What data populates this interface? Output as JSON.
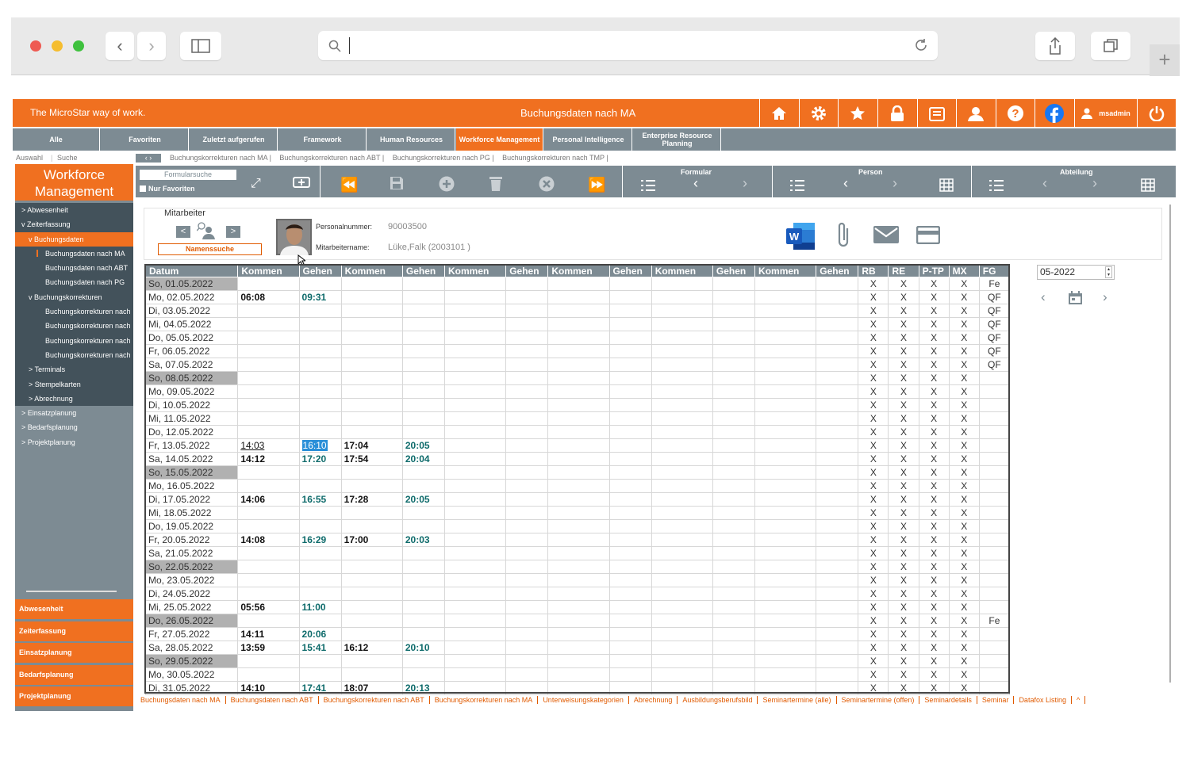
{
  "browser": {
    "address_value": ""
  },
  "app": {
    "brand": "The MicroStar way of work.",
    "page_title": "Buchungsdaten nach MA",
    "user": "msadmin",
    "nav_tabs": [
      "Alle",
      "Favoriten",
      "Zuletzt aufgerufen",
      "Framework",
      "Human Resources",
      "Workforce Management",
      "Personal Intelligence",
      "Enterprise Resource Planning"
    ],
    "sub_left": [
      "Auswahl",
      "Suche"
    ],
    "breadcrumbs": [
      "Buchungskorrekturen nach MA",
      "Buchungskorrekturen nach ABT",
      "Buchungskorrekturen nach PG",
      "Buchungskorrekturen nach TMP"
    ]
  },
  "sidebar": {
    "title": "Workforce Management",
    "tree": [
      {
        "label": "> Abwesenheit",
        "indent": 1,
        "style": "dark"
      },
      {
        "label": "v Zeiterfassung",
        "indent": 1,
        "style": "dark"
      },
      {
        "label": "v Buchungsdaten",
        "indent": 2,
        "style": "hl"
      },
      {
        "label": "Buchungsdaten nach MA",
        "indent": 3,
        "style": "dark",
        "marker": true
      },
      {
        "label": "Buchungsdaten nach ABT",
        "indent": 3,
        "style": "dark"
      },
      {
        "label": "Buchungsdaten nach PG",
        "indent": 3,
        "style": "dark"
      },
      {
        "label": "v Buchungskorrekturen",
        "indent": 2,
        "style": "dark"
      },
      {
        "label": "Buchungskorrekturen nach",
        "indent": 3,
        "style": "dark"
      },
      {
        "label": "Buchungskorrekturen nach",
        "indent": 3,
        "style": "dark"
      },
      {
        "label": "Buchungskorrekturen nach",
        "indent": 3,
        "style": "dark"
      },
      {
        "label": "Buchungskorrekturen nach",
        "indent": 3,
        "style": "dark"
      },
      {
        "label": "> Terminals",
        "indent": 2,
        "style": "dark"
      },
      {
        "label": "> Stempelkarten",
        "indent": 2,
        "style": "dark"
      },
      {
        "label": "> Abrechnung",
        "indent": 2,
        "style": "dark"
      },
      {
        "label": "> Einsatzplanung",
        "indent": 1,
        "style": ""
      },
      {
        "label": "> Bedarfsplanung",
        "indent": 1,
        "style": ""
      },
      {
        "label": "> Projektplanung",
        "indent": 1,
        "style": ""
      }
    ],
    "bottom_buttons": [
      "Abwesenheit",
      "Zeiterfassung",
      "Einsatzplanung",
      "Bedarfsplanung",
      "Projektplanung"
    ]
  },
  "toolbar": {
    "form_search": "Formularsuche",
    "only_favorites": "Nur Favoriten",
    "groups": [
      "Formular",
      "Person",
      "Abteilung"
    ]
  },
  "employee": {
    "legend": "Mitarbeiter",
    "name_search": "Namenssuche",
    "personal_number_label": "Personalnummer:",
    "personal_number": "90003500",
    "name_label": "Mitarbeitername:",
    "name": "Lüke,Falk (2003101 )"
  },
  "period": {
    "value": "05-2022"
  },
  "grid": {
    "headers": [
      "Datum",
      "Kommen",
      "Gehen",
      "Kommen",
      "Gehen",
      "Kommen",
      "Gehen",
      "Kommen",
      "Gehen",
      "Kommen",
      "Gehen",
      "Kommen",
      "Gehen",
      "RB",
      "RE",
      "P-TP",
      "MX",
      "FG"
    ],
    "rows": [
      [
        "So, 01.05.2022",
        "",
        "",
        "",
        "",
        "X",
        "X",
        "X",
        "X",
        "Fe",
        true
      ],
      [
        "Mo, 02.05.2022",
        "06:08",
        "09:31",
        "",
        "",
        "X",
        "X",
        "X",
        "X",
        "QF",
        false
      ],
      [
        "Di, 03.05.2022",
        "",
        "",
        "",
        "",
        "X",
        "X",
        "X",
        "X",
        "QF",
        false
      ],
      [
        "Mi, 04.05.2022",
        "",
        "",
        "",
        "",
        "X",
        "X",
        "X",
        "X",
        "QF",
        false
      ],
      [
        "Do, 05.05.2022",
        "",
        "",
        "",
        "",
        "X",
        "X",
        "X",
        "X",
        "QF",
        false
      ],
      [
        "Fr, 06.05.2022",
        "",
        "",
        "",
        "",
        "X",
        "X",
        "X",
        "X",
        "QF",
        false
      ],
      [
        "Sa, 07.05.2022",
        "",
        "",
        "",
        "",
        "X",
        "X",
        "X",
        "X",
        "QF",
        false
      ],
      [
        "So, 08.05.2022",
        "",
        "",
        "",
        "",
        "X",
        "X",
        "X",
        "X",
        "",
        true
      ],
      [
        "Mo, 09.05.2022",
        "",
        "",
        "",
        "",
        "X",
        "X",
        "X",
        "X",
        "",
        false
      ],
      [
        "Di, 10.05.2022",
        "",
        "",
        "",
        "",
        "X",
        "X",
        "X",
        "X",
        "",
        false
      ],
      [
        "Mi, 11.05.2022",
        "",
        "",
        "",
        "",
        "X",
        "X",
        "X",
        "X",
        "",
        false
      ],
      [
        "Do, 12.05.2022",
        "",
        "",
        "",
        "",
        "X",
        "X",
        "X",
        "X",
        "",
        false
      ],
      [
        "Fr, 13.05.2022",
        "14:03",
        "16:10",
        "17:04",
        "20:05",
        "X",
        "X",
        "X",
        "X",
        "",
        false
      ],
      [
        "Sa, 14.05.2022",
        "14:12",
        "17:20",
        "17:54",
        "20:04",
        "X",
        "X",
        "X",
        "X",
        "",
        false
      ],
      [
        "So, 15.05.2022",
        "",
        "",
        "",
        "",
        "X",
        "X",
        "X",
        "X",
        "",
        true
      ],
      [
        "Mo, 16.05.2022",
        "",
        "",
        "",
        "",
        "X",
        "X",
        "X",
        "X",
        "",
        false
      ],
      [
        "Di, 17.05.2022",
        "14:06",
        "16:55",
        "17:28",
        "20:05",
        "X",
        "X",
        "X",
        "X",
        "",
        false
      ],
      [
        "Mi, 18.05.2022",
        "",
        "",
        "",
        "",
        "X",
        "X",
        "X",
        "X",
        "",
        false
      ],
      [
        "Do, 19.05.2022",
        "",
        "",
        "",
        "",
        "X",
        "X",
        "X",
        "X",
        "",
        false
      ],
      [
        "Fr, 20.05.2022",
        "14:08",
        "16:29",
        "17:00",
        "20:03",
        "X",
        "X",
        "X",
        "X",
        "",
        false
      ],
      [
        "Sa, 21.05.2022",
        "",
        "",
        "",
        "",
        "X",
        "X",
        "X",
        "X",
        "",
        false
      ],
      [
        "So, 22.05.2022",
        "",
        "",
        "",
        "",
        "X",
        "X",
        "X",
        "X",
        "",
        true
      ],
      [
        "Mo, 23.05.2022",
        "",
        "",
        "",
        "",
        "X",
        "X",
        "X",
        "X",
        "",
        false
      ],
      [
        "Di, 24.05.2022",
        "",
        "",
        "",
        "",
        "X",
        "X",
        "X",
        "X",
        "",
        false
      ],
      [
        "Mi, 25.05.2022",
        "05:56",
        "11:00",
        "",
        "",
        "X",
        "X",
        "X",
        "X",
        "",
        false
      ],
      [
        "Do, 26.05.2022",
        "",
        "",
        "",
        "",
        "X",
        "X",
        "X",
        "X",
        "Fe",
        true
      ],
      [
        "Fr, 27.05.2022",
        "14:11",
        "20:06",
        "",
        "",
        "X",
        "X",
        "X",
        "X",
        "",
        false
      ],
      [
        "Sa, 28.05.2022",
        "13:59",
        "15:41",
        "16:12",
        "20:10",
        "X",
        "X",
        "X",
        "X",
        "",
        false
      ],
      [
        "So, 29.05.2022",
        "",
        "",
        "",
        "",
        "X",
        "X",
        "X",
        "X",
        "",
        true
      ],
      [
        "Mo, 30.05.2022",
        "",
        "",
        "",
        "",
        "X",
        "X",
        "X",
        "X",
        "",
        false
      ],
      [
        "Di, 31.05.2022",
        "14:10",
        "17:41",
        "18:07",
        "20:13",
        "X",
        "X",
        "X",
        "X",
        "",
        false
      ]
    ]
  },
  "footer_links": [
    "Buchungsdaten nach MA",
    "Buchungsdaten nach ABT",
    "Buchungskorrekturen nach ABT",
    "Buchungskorrekturen nach MA",
    "Unterweisungskategorien",
    "Abrechnung",
    "Ausbildungsberufsbild",
    "Seminartermine (alle)",
    "Seminartermine (offen)",
    "Seminardetails",
    "Seminar",
    "Datafox Listing",
    "^"
  ]
}
